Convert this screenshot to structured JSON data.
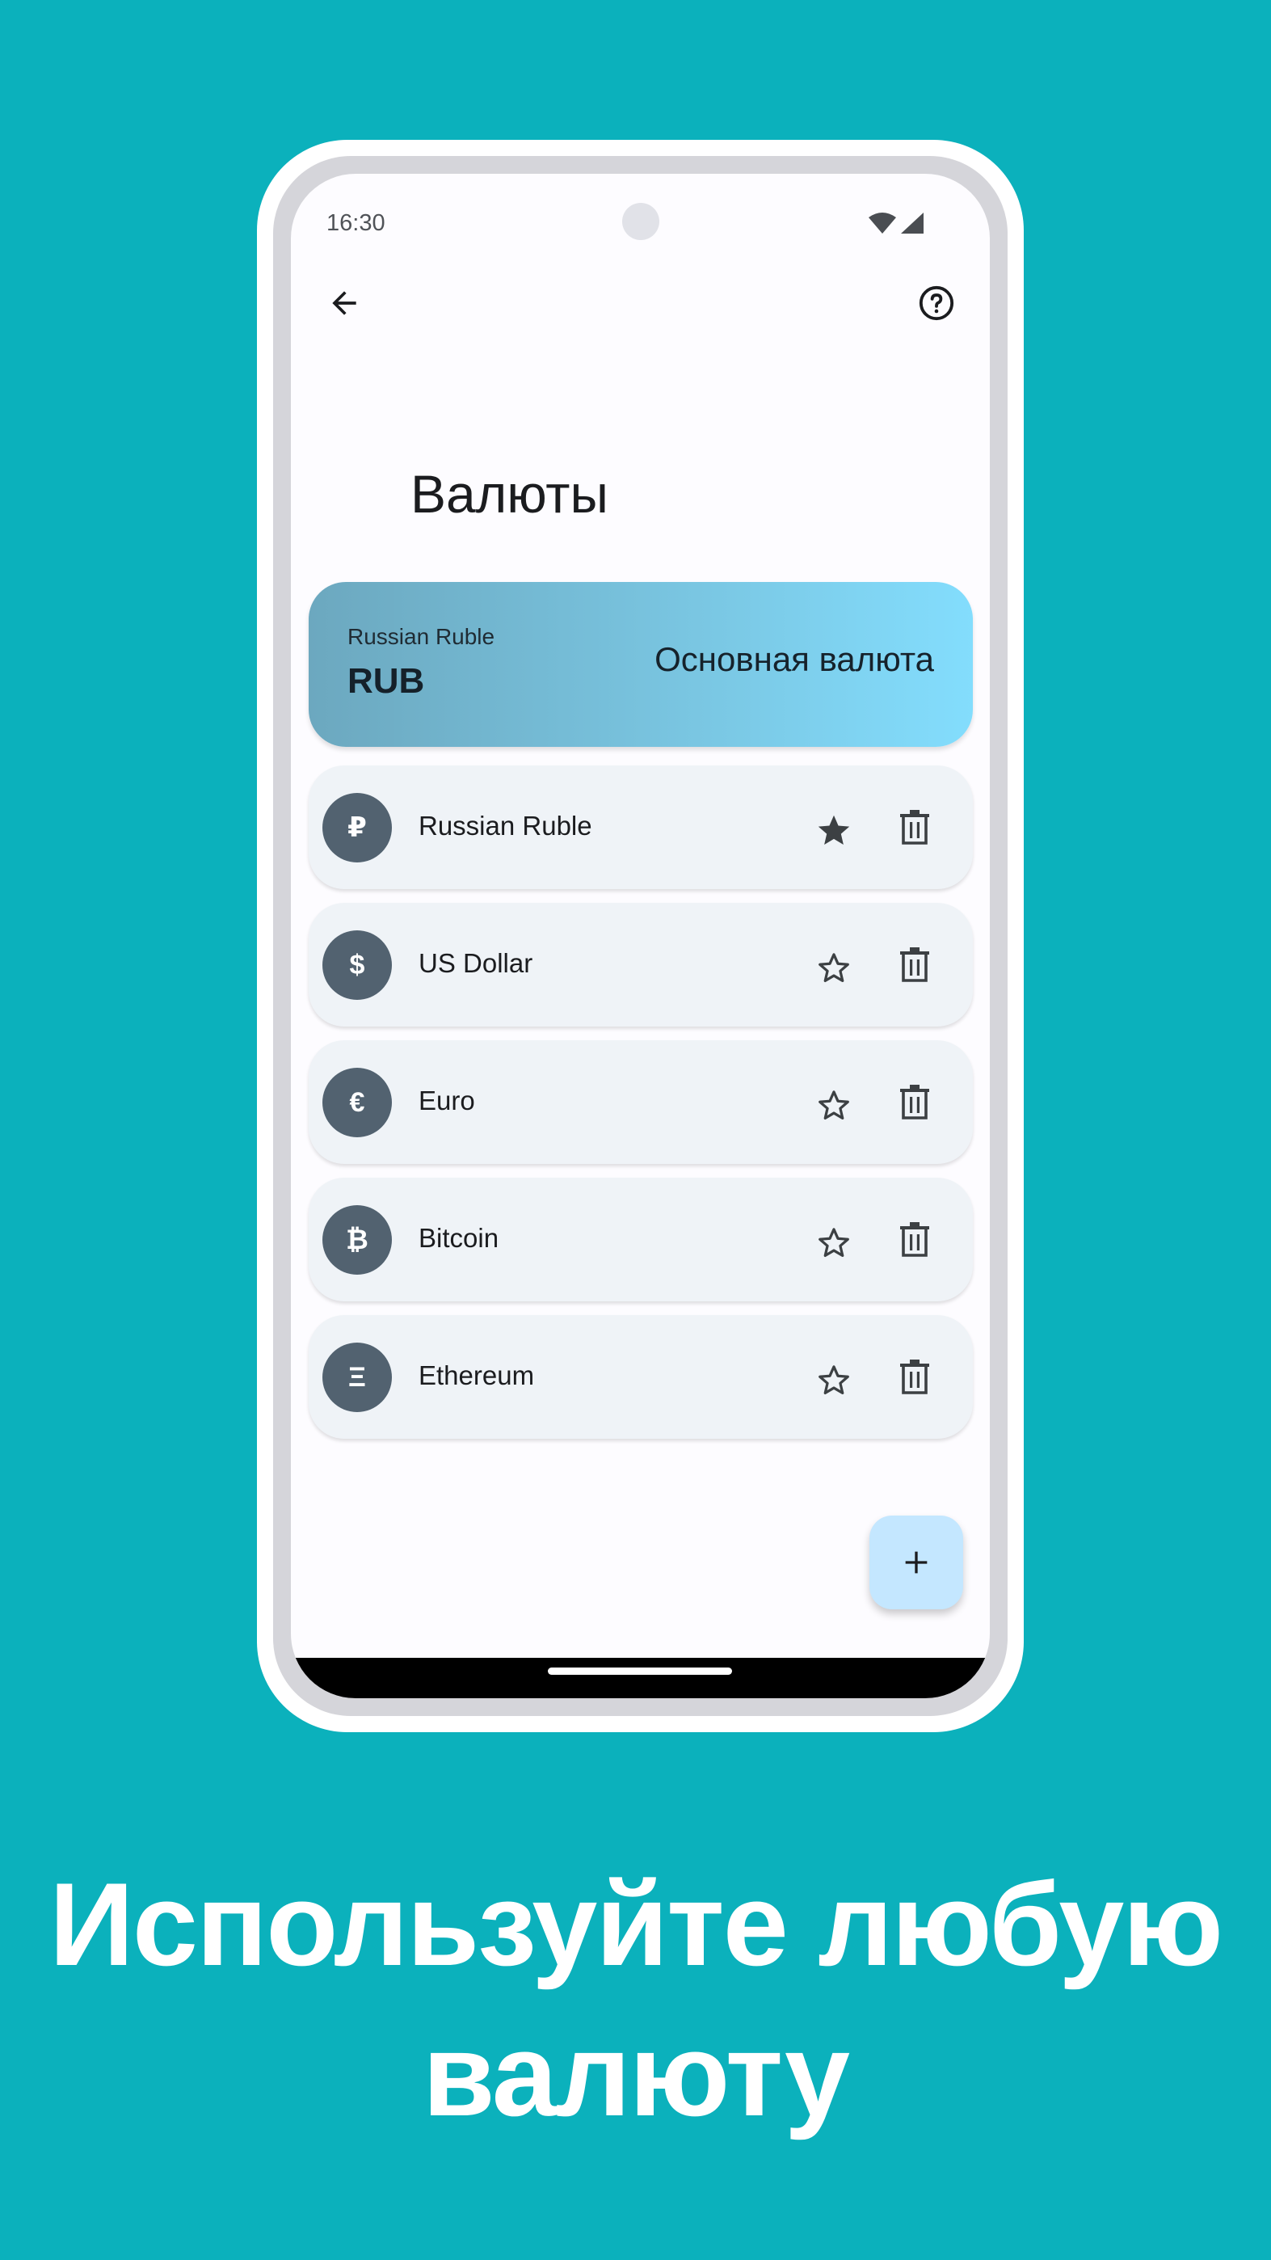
{
  "status_bar": {
    "time": "16:30",
    "icons": [
      "wifi-icon",
      "signal-icon"
    ]
  },
  "app_bar": {
    "back_icon": "arrow-back-icon",
    "help_icon": "help-circle-icon"
  },
  "page": {
    "title": "Валюты"
  },
  "main_currency": {
    "name": "Russian Ruble",
    "code": "RUB",
    "label": "Основная валюта"
  },
  "currencies": [
    {
      "symbol": "₽",
      "name": "Russian Ruble",
      "favorite": true
    },
    {
      "symbol": "$",
      "name": "US Dollar",
      "favorite": false
    },
    {
      "symbol": "€",
      "name": "Euro",
      "favorite": false
    },
    {
      "symbol": "₿",
      "name": "Bitcoin",
      "favorite": false
    },
    {
      "symbol": "Ξ",
      "name": "Ethereum",
      "favorite": false
    }
  ],
  "fab": {
    "icon": "plus-icon"
  },
  "caption": {
    "line1": "Используйте любую",
    "line2": "валюту"
  },
  "colors": {
    "background": "#0BB1BC",
    "avatar": "#526270",
    "fab": "#C4E7FF"
  }
}
